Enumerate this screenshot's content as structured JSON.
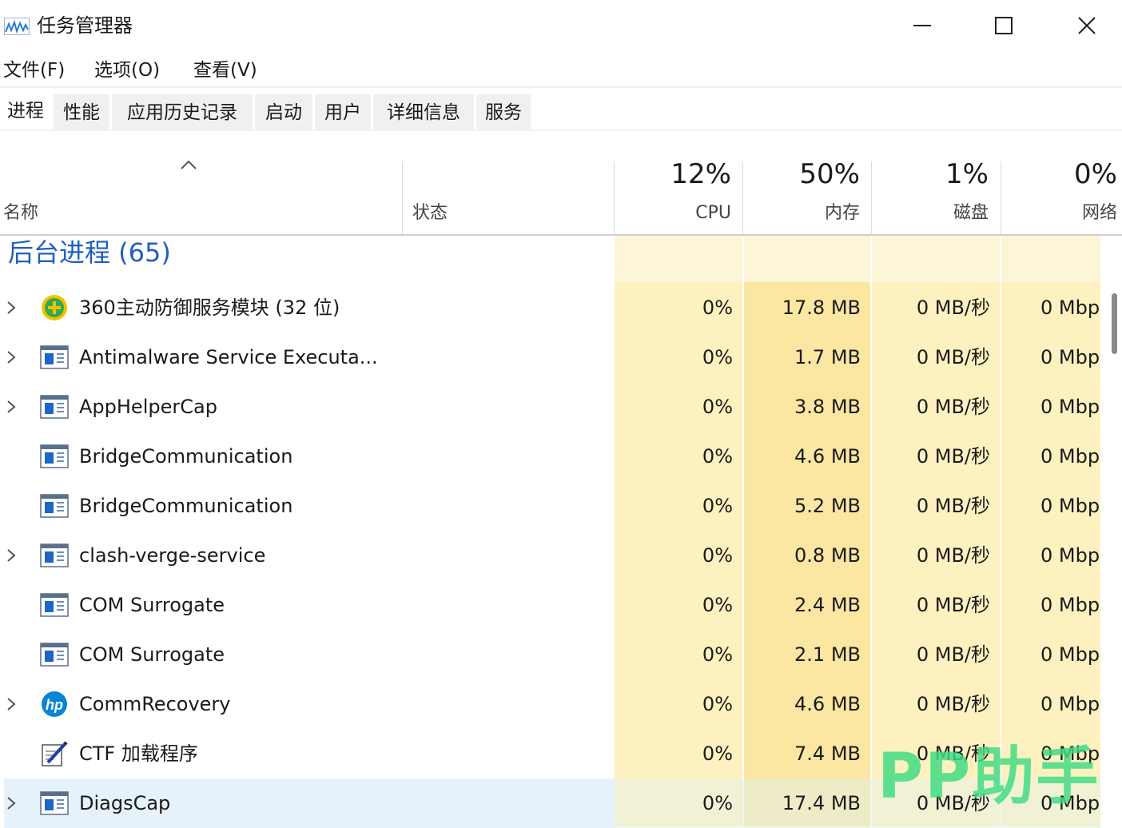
{
  "window": {
    "title": "任务管理器",
    "app_icon": "task-manager-chart-icon",
    "controls": {
      "minimize": "minimize-icon",
      "maximize": "maximize-icon",
      "close": "close-icon"
    }
  },
  "menu": [
    "文件(F)",
    "选项(O)",
    "查看(V)"
  ],
  "tabs": [
    "进程",
    "性能",
    "应用历史记录",
    "启动",
    "用户",
    "详细信息",
    "服务"
  ],
  "active_tab": "进程",
  "columns": {
    "name": "名称",
    "status": "状态",
    "cpu": {
      "percent": "12%",
      "label": "CPU"
    },
    "memory": {
      "percent": "50%",
      "label": "内存"
    },
    "disk": {
      "percent": "1%",
      "label": "磁盘"
    },
    "network": {
      "percent": "0%",
      "label": "网络"
    },
    "sort_indicator": "sort-ascending-icon"
  },
  "group": {
    "title": "后台进程 (65)"
  },
  "processes": [
    {
      "name": "360主动防御服务模块 (32 位)",
      "icon": "360-shield-icon",
      "expandable": true,
      "cpu": "0%",
      "memory": "17.8 MB",
      "disk": "0 MB/秒",
      "network": "0 Mbps"
    },
    {
      "name": "Antimalware Service Executa...",
      "icon": "app-window-icon",
      "expandable": true,
      "cpu": "0%",
      "memory": "1.7 MB",
      "disk": "0 MB/秒",
      "network": "0 Mbps"
    },
    {
      "name": "AppHelperCap",
      "icon": "app-window-icon",
      "expandable": true,
      "cpu": "0%",
      "memory": "3.8 MB",
      "disk": "0 MB/秒",
      "network": "0 Mbps"
    },
    {
      "name": "BridgeCommunication",
      "icon": "app-window-icon",
      "expandable": false,
      "cpu": "0%",
      "memory": "4.6 MB",
      "disk": "0 MB/秒",
      "network": "0 Mbps"
    },
    {
      "name": "BridgeCommunication",
      "icon": "app-window-icon",
      "expandable": false,
      "cpu": "0%",
      "memory": "5.2 MB",
      "disk": "0 MB/秒",
      "network": "0 Mbps"
    },
    {
      "name": "clash-verge-service",
      "icon": "app-window-icon",
      "expandable": true,
      "cpu": "0%",
      "memory": "0.8 MB",
      "disk": "0 MB/秒",
      "network": "0 Mbps"
    },
    {
      "name": "COM Surrogate",
      "icon": "app-window-icon",
      "expandable": false,
      "cpu": "0%",
      "memory": "2.4 MB",
      "disk": "0 MB/秒",
      "network": "0 Mbps"
    },
    {
      "name": "COM Surrogate",
      "icon": "app-window-icon",
      "expandable": false,
      "cpu": "0%",
      "memory": "2.1 MB",
      "disk": "0 MB/秒",
      "network": "0 Mbps"
    },
    {
      "name": "CommRecovery",
      "icon": "hp-logo-icon",
      "expandable": true,
      "cpu": "0%",
      "memory": "4.6 MB",
      "disk": "0 MB/秒",
      "network": "0 Mbps"
    },
    {
      "name": "CTF 加载程序",
      "icon": "ctf-pen-icon",
      "expandable": false,
      "cpu": "0%",
      "memory": "7.4 MB",
      "disk": "0 MB/秒",
      "network": "0 Mbps"
    },
    {
      "name": "DiagsCap",
      "icon": "app-window-icon",
      "expandable": true,
      "selected": true,
      "cpu": "0%",
      "memory": "17.4 MB",
      "disk": "0 MB/秒",
      "network": "0 Mbps"
    }
  ],
  "watermark": "PP助手",
  "colors": {
    "group_title": "#1f5fbf",
    "heat_light": "#fef1c0",
    "heat_memory": "#fbe6a2",
    "selection": "#e5f1fb",
    "watermark": "#3ddc84"
  }
}
